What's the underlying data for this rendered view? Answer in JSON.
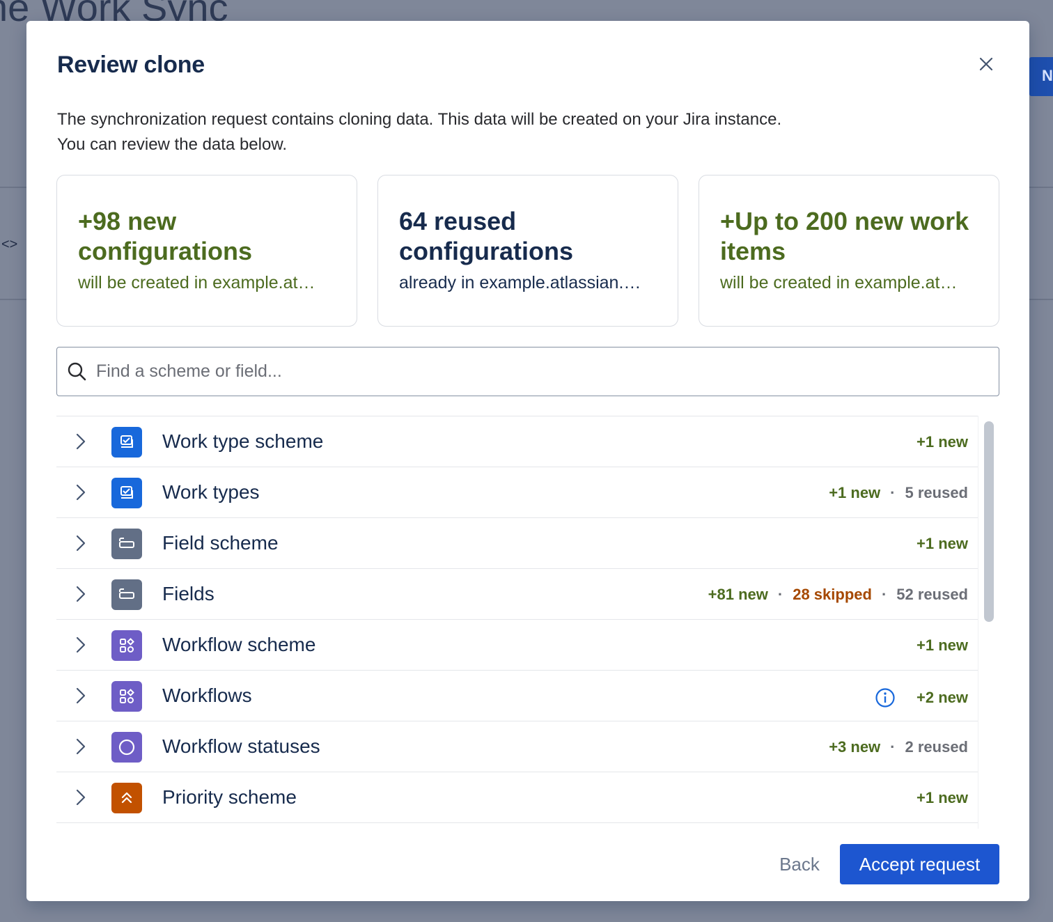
{
  "background": {
    "title": "ne Work Sync",
    "code_glyph": "<>",
    "button_letter": "N"
  },
  "modal": {
    "title": "Review clone",
    "description_line1": "The synchronization request contains cloning data. This data will be created on your Jira instance.",
    "description_line2": "You can review the data below."
  },
  "cards": [
    {
      "value": "+98 new configurations",
      "sub": "will be created in example.at…",
      "tone": "green"
    },
    {
      "value": "64 reused configurations",
      "sub": "already in example.atlassian.…",
      "tone": "dark"
    },
    {
      "value": "+Up to 200 new work items",
      "sub": "will be created in example.at…",
      "tone": "green"
    }
  ],
  "search": {
    "placeholder": "Find a scheme or field..."
  },
  "rows": [
    {
      "label": "Work type scheme",
      "icon": "work-type-icon",
      "color": "#1868db",
      "new": "+1 new"
    },
    {
      "label": "Work types",
      "icon": "work-type-icon",
      "color": "#1868db",
      "new": "+1 new",
      "reused": "5 reused"
    },
    {
      "label": "Field scheme",
      "icon": "field-icon",
      "color": "#626f86",
      "new": "+1 new"
    },
    {
      "label": "Fields",
      "icon": "field-icon",
      "color": "#626f86",
      "new": "+81 new",
      "skipped": "28 skipped",
      "reused": "52 reused"
    },
    {
      "label": "Workflow scheme",
      "icon": "workflow-icon",
      "color": "#6e5dc6",
      "new": "+1 new"
    },
    {
      "label": "Workflows",
      "icon": "workflow-icon",
      "color": "#6e5dc6",
      "new": "+2 new",
      "info": true
    },
    {
      "label": "Workflow statuses",
      "icon": "status-icon",
      "color": "#6e5dc6",
      "new": "+3 new",
      "reused": "2 reused"
    },
    {
      "label": "Priority scheme",
      "icon": "priority-icon",
      "color": "#c25100",
      "new": "+1 new"
    }
  ],
  "footer": {
    "back_label": "Back",
    "accept_label": "Accept request"
  }
}
